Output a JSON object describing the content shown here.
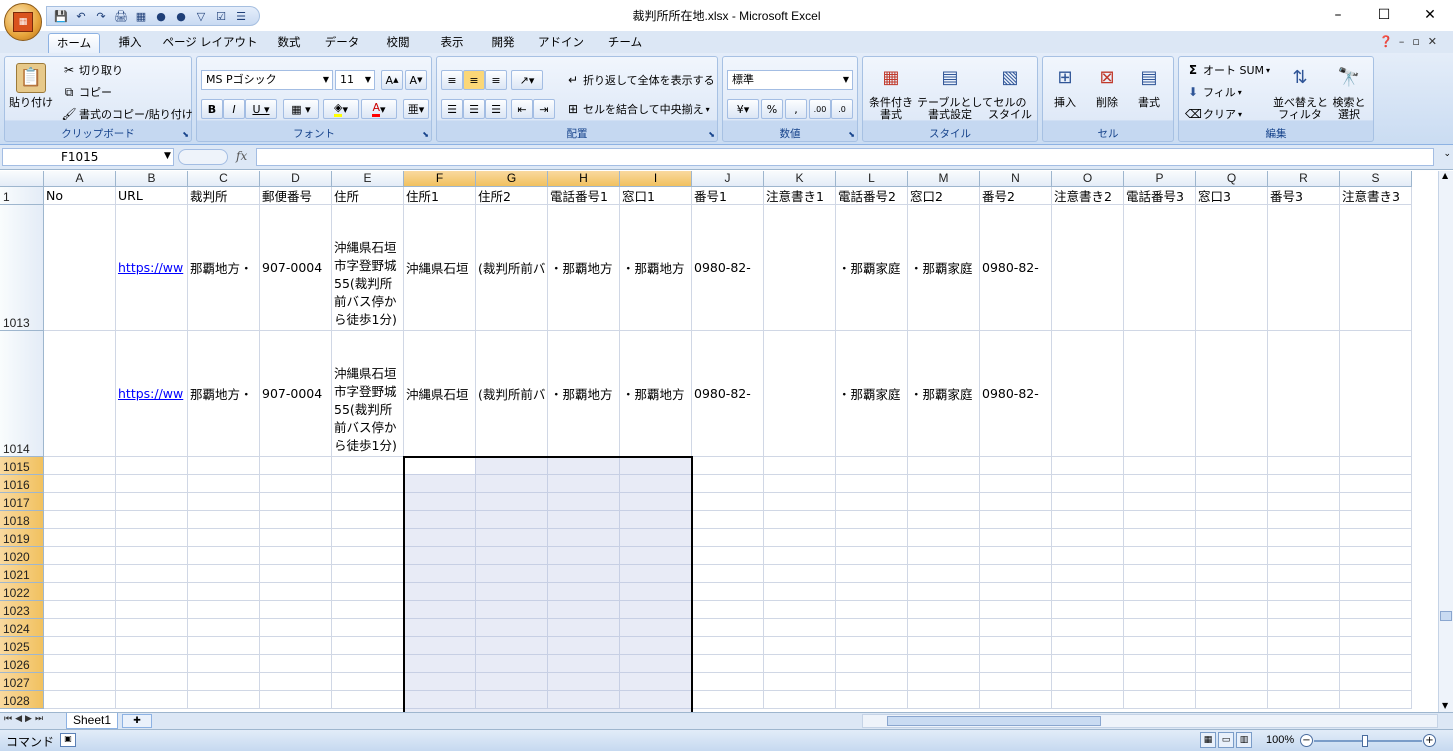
{
  "app": {
    "title": "裁判所所在地.xlsx - Microsoft Excel",
    "window_controls": [
      "–",
      "☐",
      "✕"
    ]
  },
  "quick_access": [
    "💾",
    "↶",
    "↷",
    "🖨",
    "▦",
    "●",
    "●",
    "▽",
    "☑",
    "☰"
  ],
  "tabs": [
    "ホーム",
    "挿入",
    "ページ レイアウト",
    "数式",
    "データ",
    "校閲",
    "表示",
    "開発",
    "アドイン",
    "チーム"
  ],
  "ribbon": {
    "clipboard": {
      "label": "クリップボード",
      "paste": "貼り付け",
      "cut": "切り取り",
      "copy": "コピー",
      "format_painter": "書式のコピー/貼り付け"
    },
    "font": {
      "label": "フォント",
      "name": "MS Pゴシック",
      "size": "11"
    },
    "alignment": {
      "label": "配置",
      "wrap": "折り返して全体を表示する",
      "merge": "セルを結合して中央揃え"
    },
    "number": {
      "label": "数値",
      "format": "標準"
    },
    "styles": {
      "label": "スタイル",
      "conditional": "条件付き\n書式",
      "table": "テーブルとして\n書式設定",
      "cell_styles": "セルの\nスタイル"
    },
    "cells": {
      "label": "セル",
      "insert": "挿入",
      "delete": "削除",
      "format": "書式"
    },
    "editing": {
      "label": "編集",
      "autosum": "オート SUM",
      "fill": "フィル",
      "clear": "クリア",
      "sort": "並べ替えと\nフィルタ",
      "find": "検索と\n選択"
    }
  },
  "formula_bar": {
    "name_box": "F1015",
    "fx": "fx",
    "value": ""
  },
  "columns": [
    "A",
    "B",
    "C",
    "D",
    "E",
    "F",
    "G",
    "H",
    "I",
    "J",
    "K",
    "L",
    "M",
    "N",
    "O",
    "P",
    "Q",
    "R",
    "S"
  ],
  "selected_columns": [
    "F",
    "G",
    "H",
    "I"
  ],
  "header_row": {
    "num": "1",
    "cells": [
      "No",
      "URL",
      "裁判所",
      "郵便番号",
      "住所",
      "住所1",
      "住所2",
      "電話番号1",
      "窓口1",
      "番号1",
      "注意書き1",
      "電話番号2",
      "窓口2",
      "番号2",
      "注意書き2",
      "電話番号3",
      "窓口3",
      "番号3",
      "注意書き3"
    ]
  },
  "data_rows": [
    {
      "num": "1013",
      "cells": [
        "",
        "https://ww",
        "那覇地方・",
        "907-0004",
        "沖縄県石垣市字登野城55(裁判所前バス停から徒歩1分)",
        "沖縄県石垣",
        "(裁判所前バ",
        "・那覇地方",
        "・那覇地方",
        "0980-82-",
        "",
        "・那覇家庭",
        "・那覇家庭",
        "0980-82-",
        "",
        "",
        "",
        "",
        ""
      ]
    },
    {
      "num": "1014",
      "cells": [
        "",
        "https://ww",
        "那覇地方・",
        "907-0004",
        "沖縄県石垣市字登野城55(裁判所前バス停から徒歩1分)",
        "沖縄県石垣",
        "(裁判所前バ",
        "・那覇地方",
        "・那覇地方",
        "0980-82-",
        "",
        "・那覇家庭",
        "・那覇家庭",
        "0980-82-",
        "",
        "",
        "",
        "",
        ""
      ]
    }
  ],
  "empty_rows": [
    "1015",
    "1016",
    "1017",
    "1018",
    "1019",
    "1020",
    "1021",
    "1022",
    "1023",
    "1024",
    "1025",
    "1026",
    "1027",
    "1028"
  ],
  "selected_rows": [
    "1015",
    "1016",
    "1017",
    "1018",
    "1019",
    "1020",
    "1021",
    "1022",
    "1023",
    "1024",
    "1025",
    "1026",
    "1027",
    "1028"
  ],
  "sheet": {
    "name": "Sheet1"
  },
  "status": {
    "mode": "コマンド",
    "zoom": "100%"
  },
  "colors": {
    "accent": "#4a7ac0",
    "selection_header": "#f1c15f",
    "ribbon_bg": "#dce7f5",
    "link": "#0000ff"
  }
}
